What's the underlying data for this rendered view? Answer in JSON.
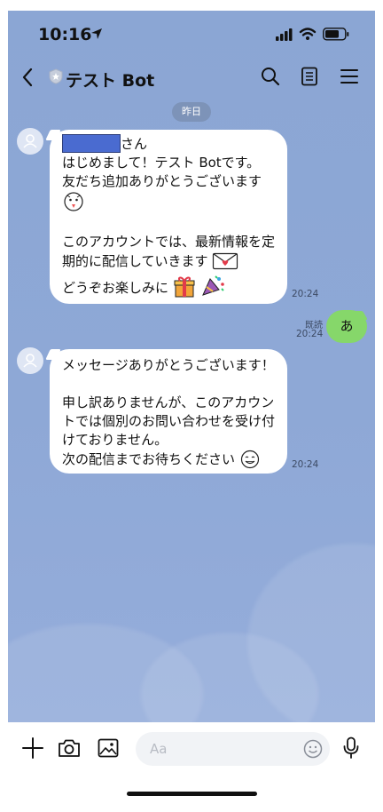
{
  "status": {
    "time": "10:16"
  },
  "header": {
    "title": "テスト Bot"
  },
  "date_chip": "昨日",
  "messages": [
    {
      "sender": "bot",
      "suffix": "さん",
      "lines": [
        "はじめまして！テスト Botです。",
        "友だち追加ありがとうございます",
        "",
        "このアカウントでは、最新情報を定",
        "期的に配信していきます",
        "どうぞお楽しみに"
      ],
      "time": "20:24"
    },
    {
      "sender": "me",
      "text": "あ",
      "read": "既読",
      "time": "20:24"
    },
    {
      "sender": "bot",
      "lines": [
        "メッセージありがとうございます！",
        "",
        "申し訳ありませんが、このアカウン",
        "トでは個別のお問い合わせを受け付",
        "けておりません。",
        "次の配信までお待ちください"
      ],
      "time": "20:24"
    }
  ],
  "input": {
    "placeholder": "Aa"
  },
  "colors": {
    "chat_bg": "#8ea8d6",
    "my_bubble": "#86d76a",
    "redaction": "#4a6bd0"
  },
  "icons": [
    "location-arrow-icon",
    "signal-icon",
    "wifi-icon",
    "battery-icon",
    "back-icon",
    "shield-icon",
    "search-icon",
    "notes-icon",
    "menu-icon",
    "plus-icon",
    "camera-icon",
    "image-icon",
    "emoji-icon",
    "mic-icon"
  ]
}
